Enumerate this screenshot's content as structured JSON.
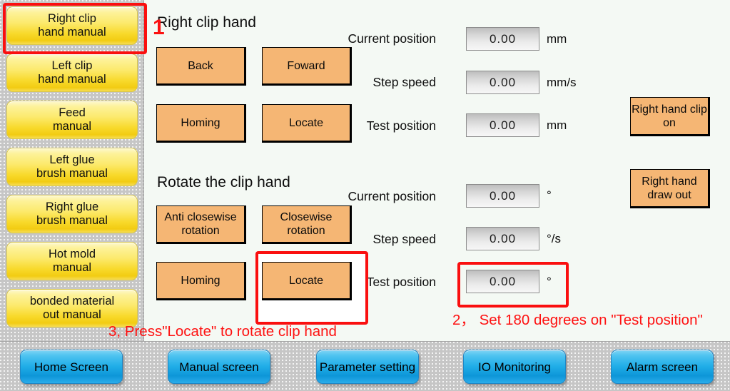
{
  "colors": {
    "sidebar_button": "#f8d92a",
    "operation_button": "#f5b674",
    "nav_button": "#21aee8",
    "annotation_red": "#fa0f0f",
    "background": "#f4f9f4",
    "panel_texture": "#c6c6c6"
  },
  "sidebar": {
    "items": [
      {
        "line1": "Right clip",
        "line2": "hand manual",
        "selected": true
      },
      {
        "line1": "Left clip",
        "line2": "hand manual",
        "selected": false
      },
      {
        "line1": "Feed",
        "line2": "manual",
        "selected": false
      },
      {
        "line1": "Left glue",
        "line2": "brush manual",
        "selected": false
      },
      {
        "line1": "Right glue",
        "line2": "brush manual",
        "selected": false
      },
      {
        "line1": "Hot mold",
        "line2": "manual",
        "selected": false
      },
      {
        "line1": "bonded material",
        "line2": "out manual",
        "selected": false
      }
    ]
  },
  "main": {
    "sections": [
      {
        "title": "Right clip hand",
        "buttons": [
          {
            "line1": "Back",
            "line2": ""
          },
          {
            "line1": "Foward",
            "line2": ""
          },
          {
            "line1": "Homing",
            "line2": ""
          },
          {
            "line1": "Locate",
            "line2": ""
          }
        ],
        "fields": [
          {
            "label": "Current position",
            "value": "0.00",
            "unit": "mm"
          },
          {
            "label": "Step speed",
            "value": "0.00",
            "unit": "mm/s"
          },
          {
            "label": "Test position",
            "value": "0.00",
            "unit": "mm"
          }
        ]
      },
      {
        "title": "Rotate the clip hand",
        "buttons": [
          {
            "line1": "Anti closewise",
            "line2": "rotation"
          },
          {
            "line1": "Closewise",
            "line2": "rotation"
          },
          {
            "line1": "Homing",
            "line2": ""
          },
          {
            "line1": "Locate",
            "line2": ""
          }
        ],
        "fields": [
          {
            "label": "Current position",
            "value": "0.00",
            "unit": "°"
          },
          {
            "label": "Step speed",
            "value": "0.00",
            "unit": "°/s"
          },
          {
            "label": "Test position",
            "value": "0.00",
            "unit": "°"
          }
        ]
      }
    ],
    "side_actions": [
      {
        "line1": "Right hand",
        "line2": "clip on"
      },
      {
        "line1": "Right hand",
        "line2": "draw out"
      }
    ]
  },
  "annotations": {
    "step1_marker": "1",
    "step2_text": "2， Set 180 degrees on \"Test position\"",
    "step3_text": "3, Press\"Locate\" to rotate clip hand"
  },
  "bottom_nav": {
    "items": [
      {
        "line1": "Home Screen",
        "line2": ""
      },
      {
        "line1": "Manual screen",
        "line2": ""
      },
      {
        "line1": "Parameter",
        "line2": "setting"
      },
      {
        "line1": "IO Monitoring",
        "line2": ""
      },
      {
        "line1": "Alarm screen",
        "line2": ""
      }
    ]
  }
}
